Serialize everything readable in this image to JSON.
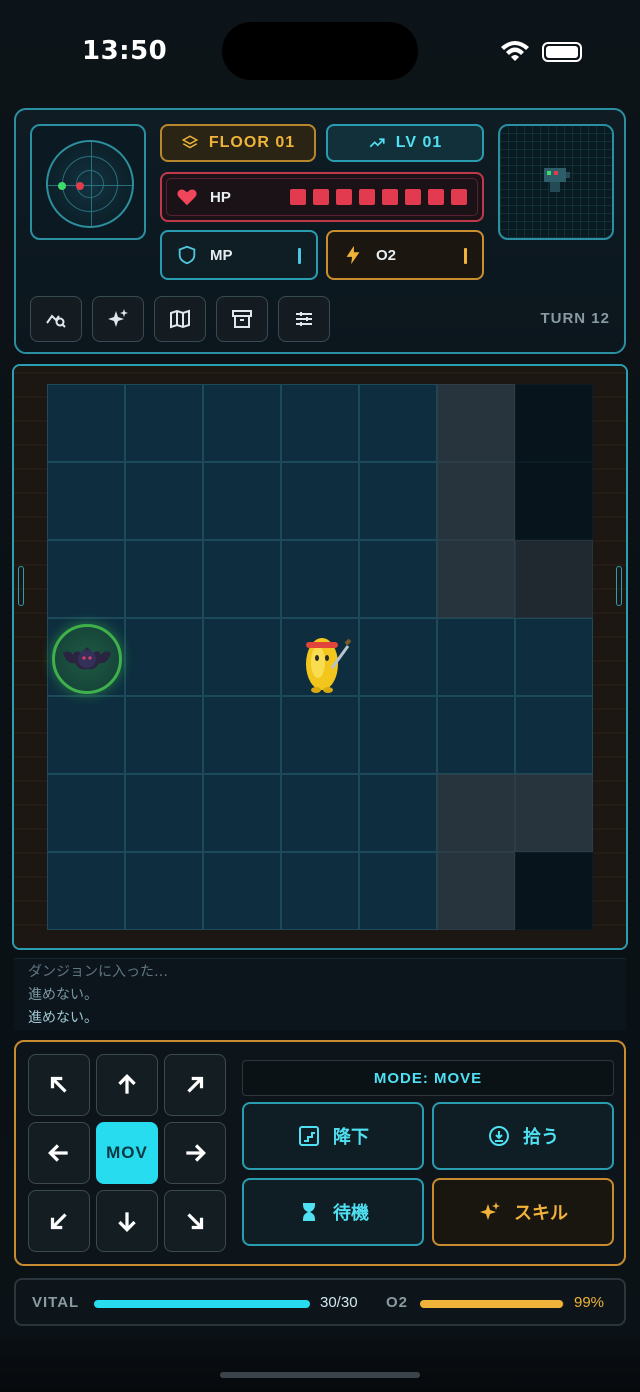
{
  "status_bar": {
    "time": "13:50"
  },
  "hud": {
    "floor_label": "FLOOR 01",
    "level_label": "LV 01",
    "hp_label": "HP",
    "hp_cells": 8,
    "mp_label": "MP",
    "o2_label": "O2",
    "turn_label": "TURN 12",
    "tools": [
      "stats-icon",
      "sparkles-icon",
      "map-icon",
      "archive-icon",
      "sliders-icon"
    ]
  },
  "board": {
    "columns": 7,
    "rows": 7,
    "enemy": "bat",
    "player": "yellow-hero"
  },
  "log": {
    "lines": [
      "ダンジョンに入った…",
      "進めない。",
      "進めない。"
    ]
  },
  "controls": {
    "center_label": "MOV",
    "mode_label": "MODE: MOVE",
    "descend_label": "降下",
    "pickup_label": "拾う",
    "wait_label": "待機",
    "skill_label": "スキル"
  },
  "vital": {
    "vital_label": "VITAL",
    "vital_value": "30/30",
    "vital_fraction": 1.0,
    "o2_label": "O2",
    "o2_value": "99%",
    "o2_fraction": 0.99
  },
  "colors": {
    "cyan": "#27dcef",
    "amber": "#f0b33a",
    "hp_red": "#e23a4e"
  }
}
